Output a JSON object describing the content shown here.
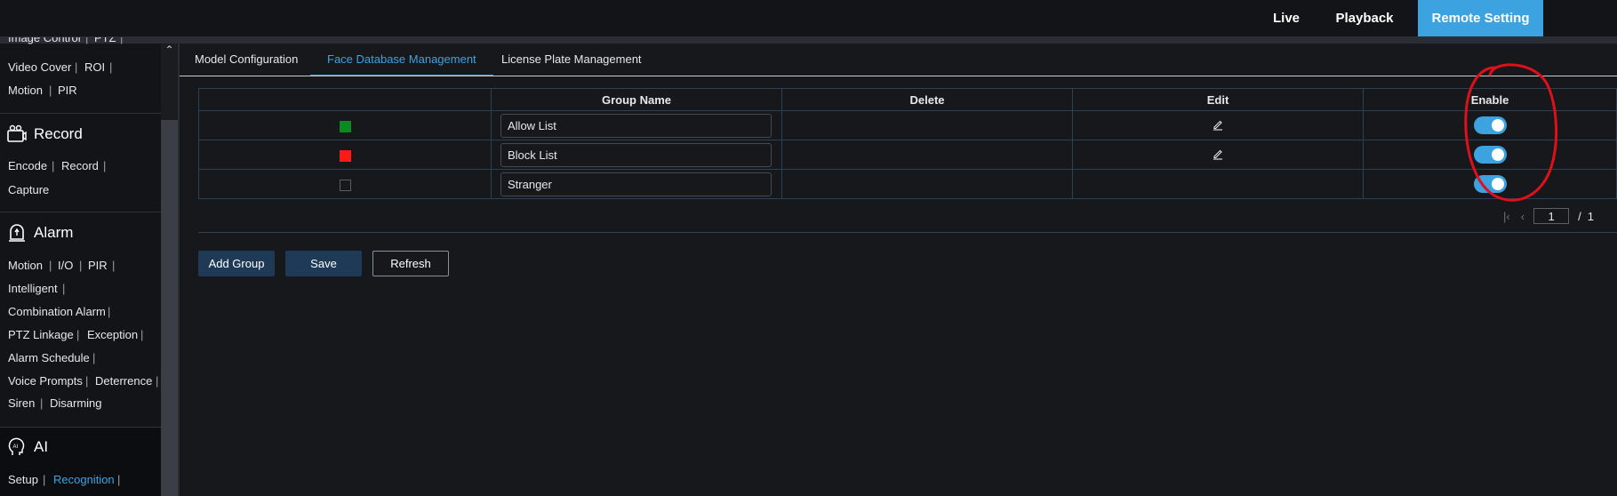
{
  "topnav": {
    "live": "Live",
    "playback": "Playback",
    "remote_setting": "Remote Setting"
  },
  "sidebar": {
    "partial_row": {
      "image_control": "Image Control",
      "ptz": "PTZ"
    },
    "video_cover": "Video Cover",
    "roi": "ROI",
    "motion": "Motion",
    "pir": "PIR",
    "record_section": {
      "title": "Record",
      "encode": "Encode",
      "record": "Record",
      "capture": "Capture"
    },
    "alarm_section": {
      "title": "Alarm",
      "motion": "Motion",
      "io": "I/O",
      "pir": "PIR",
      "intelligent": "Intelligent",
      "combination_alarm": "Combination Alarm",
      "ptz_linkage": "PTZ Linkage",
      "exception": "Exception",
      "alarm_schedule": "Alarm Schedule",
      "voice_prompts": "Voice Prompts",
      "deterrence": "Deterrence",
      "siren": "Siren",
      "disarming": "Disarming"
    },
    "ai_section": {
      "title": "AI",
      "setup": "Setup",
      "recognition": "Recognition"
    },
    "separator": "|"
  },
  "tabs": {
    "model_configuration": "Model Configuration",
    "face_database_management": "Face Database Management",
    "license_plate_management": "License Plate Management"
  },
  "table": {
    "headers": {
      "color": "",
      "group_name": "Group Name",
      "delete": "Delete",
      "edit": "Edit",
      "enable": "Enable"
    },
    "rows": [
      {
        "color": "#0a8a1f",
        "name": "Allow List",
        "editable": true,
        "enabled": true
      },
      {
        "color": "#ff1a1a",
        "name": "Block List",
        "editable": true,
        "enabled": true
      },
      {
        "color": "none",
        "name": "Stranger",
        "editable": false,
        "enabled": true
      }
    ]
  },
  "pager": {
    "current": "1",
    "separator": "/",
    "total": "1"
  },
  "buttons": {
    "add_group": "Add Group",
    "save": "Save",
    "refresh": "Refresh"
  },
  "colors": {
    "accent": "#3ca3e0",
    "annotation": "#e0101a",
    "dark_button": "#1f3a57"
  },
  "icons": [
    "pencil-edit-icon",
    "record-camera-icon",
    "alarm-bell-icon",
    "ai-head-icon",
    "first-page-icon",
    "prev-page-icon",
    "scroll-up-icon"
  ]
}
